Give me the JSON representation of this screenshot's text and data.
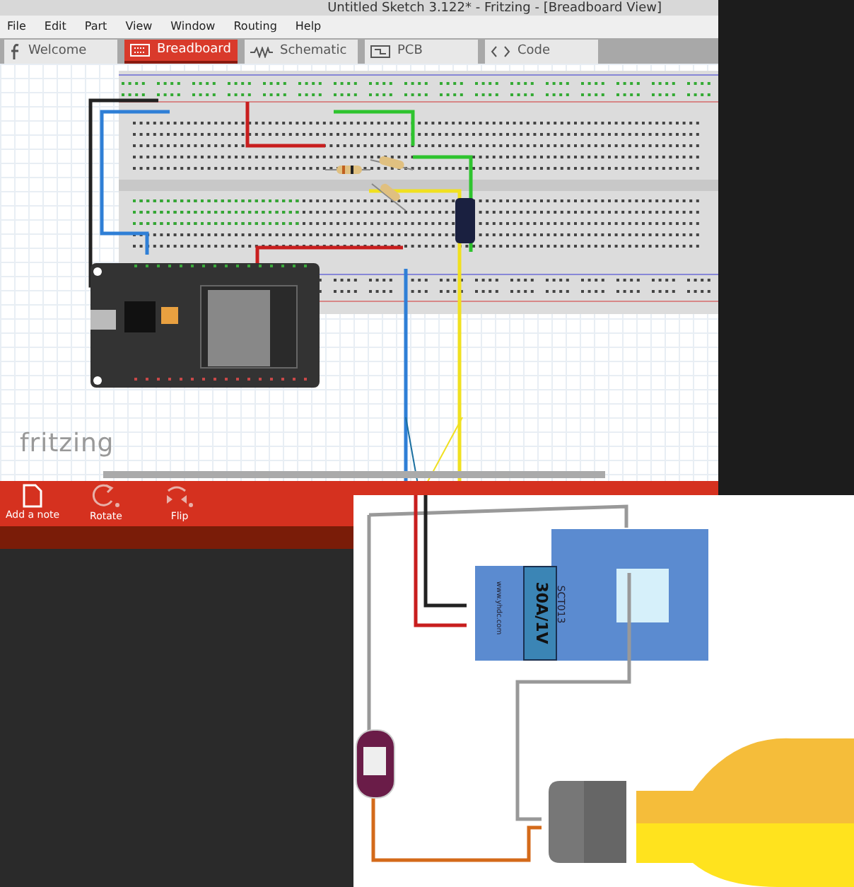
{
  "window": {
    "title": "Untitled Sketch 3.122* - Fritzing - [Breadboard View]"
  },
  "menu": [
    "File",
    "Edit",
    "Part",
    "View",
    "Window",
    "Routing",
    "Help"
  ],
  "tabs": [
    {
      "label": "Welcome",
      "kind": "welcome",
      "selected": false
    },
    {
      "label": "Breadboard",
      "kind": "breadboard",
      "selected": true
    },
    {
      "label": "Schematic",
      "kind": "schematic",
      "selected": false
    },
    {
      "label": "PCB",
      "kind": "pcb",
      "selected": false
    },
    {
      "label": "Code",
      "kind": "code",
      "selected": false
    }
  ],
  "canvas": {
    "logo": "fritzing"
  },
  "toolbar": [
    {
      "label": "Add a note",
      "kind": "note"
    },
    {
      "label": "Rotate",
      "kind": "rotate"
    },
    {
      "label": "Flip",
      "kind": "flip"
    }
  ],
  "diagram": {
    "sensor_brand": "www.yhdc.com",
    "sensor_rating": "30A/1V",
    "sensor_model": "SCT013"
  }
}
